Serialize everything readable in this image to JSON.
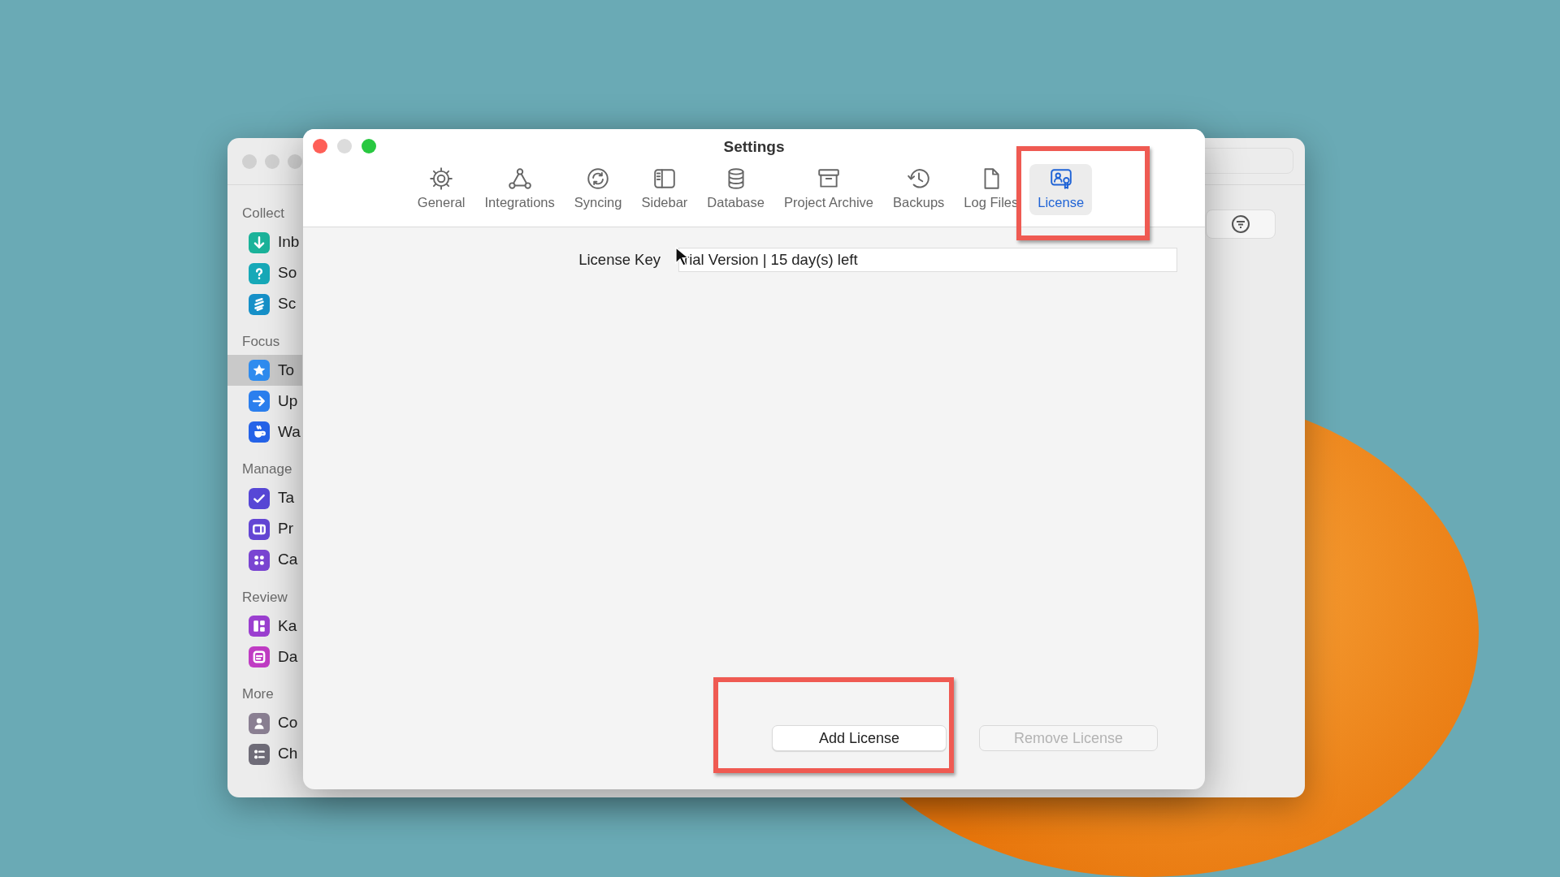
{
  "back_window": {
    "sidebar": [
      {
        "heading": "Collect",
        "items": [
          {
            "label": "Inb",
            "color": "#1bb39a",
            "selected": false
          },
          {
            "label": "So",
            "color": "#17a9b8",
            "selected": false
          },
          {
            "label": "Sc",
            "color": "#1690c8",
            "selected": false
          }
        ]
      },
      {
        "heading": "Focus",
        "items": [
          {
            "label": "To",
            "color": "#2f8cef",
            "selected": true
          },
          {
            "label": "Up",
            "color": "#2b7fee",
            "selected": false
          },
          {
            "label": "Wa",
            "color": "#2563e8",
            "selected": false
          }
        ]
      },
      {
        "heading": "Manage",
        "items": [
          {
            "label": "Ta",
            "color": "#5747d6",
            "selected": false
          },
          {
            "label": "Pr",
            "color": "#6346d4",
            "selected": false
          },
          {
            "label": "Ca",
            "color": "#7a45d2",
            "selected": false
          }
        ]
      },
      {
        "heading": "Review",
        "items": [
          {
            "label": "Ka",
            "color": "#9b3fd0",
            "selected": false
          },
          {
            "label": "Da",
            "color": "#c03cc4",
            "selected": false
          }
        ]
      },
      {
        "heading": "More",
        "items": [
          {
            "label": "Co",
            "color": "#8a7f92",
            "selected": false
          },
          {
            "label": "Ch",
            "color": "#6f6c78",
            "selected": false
          }
        ]
      }
    ]
  },
  "settings_window": {
    "title": "Settings",
    "tabs": [
      {
        "label": "General",
        "selected": false
      },
      {
        "label": "Integrations",
        "selected": false
      },
      {
        "label": "Syncing",
        "selected": false
      },
      {
        "label": "Sidebar",
        "selected": false
      },
      {
        "label": "Database",
        "selected": false
      },
      {
        "label": "Project Archive",
        "selected": false
      },
      {
        "label": "Backups",
        "selected": false
      },
      {
        "label": "Log Files",
        "selected": false
      },
      {
        "label": "License",
        "selected": true
      }
    ],
    "license_key": {
      "label": "License Key",
      "value": "rial Version | 15 day(s) left"
    },
    "buttons": [
      {
        "label": "Add License",
        "disabled": false
      },
      {
        "label": "Remove License",
        "disabled": true
      }
    ]
  }
}
